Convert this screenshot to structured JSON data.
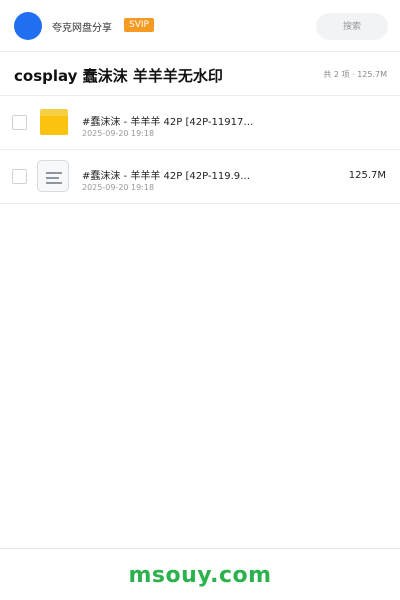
{
  "header": {
    "brand": "夸克网盘分享",
    "badge": "SVIP",
    "search_placeholder": "搜索"
  },
  "title_bar": {
    "title": "cosplay 蠢沫沫 羊羊羊无水印",
    "summary": "共 2 项 · 125.7M"
  },
  "files": [
    {
      "type": "folder",
      "icon": "folder-icon",
      "name": "#蠢沫沫 - 羊羊羊 42P [42P-11917…",
      "date": "2025-09-20 19:18",
      "size": ""
    },
    {
      "type": "file",
      "icon": "document-icon",
      "name": "#蠢沫沫 - 羊羊羊 42P [42P-119.9…",
      "date": "2025-09-20 19:18",
      "size": "125.7M"
    }
  ],
  "footer": {
    "watermark": "msouy.com"
  },
  "colors": {
    "avatar": "#1f6ff0",
    "badge": "#f59a23",
    "folder": "#fbc20f",
    "watermark": "#2bb24c"
  }
}
